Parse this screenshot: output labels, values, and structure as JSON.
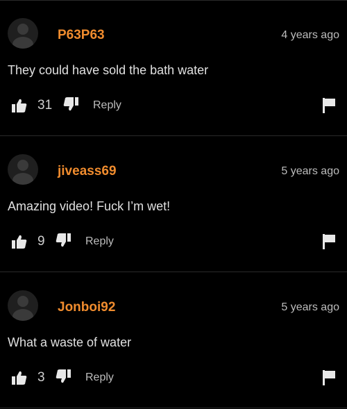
{
  "comments": [
    {
      "username": "P63P63",
      "timestamp": "4 years ago",
      "text": "They could have sold the bath water",
      "votes": "31",
      "reply_label": "Reply",
      "avatar_icon": "default-avatar-icon",
      "flag_icon": "flag-icon"
    },
    {
      "username": "jiveass69",
      "timestamp": "5 years ago",
      "text": "Amazing video! Fuck I’m wet!",
      "votes": "9",
      "reply_label": "Reply",
      "avatar_icon": "default-avatar-icon",
      "flag_icon": "flag-icon"
    },
    {
      "username": "Jonboi92",
      "timestamp": "5 years ago",
      "text": "What a waste of water",
      "votes": "3",
      "reply_label": "Reply",
      "avatar_icon": "default-avatar-icon",
      "flag_icon": "flag-icon"
    }
  ],
  "colors": {
    "background": "#000000",
    "username": "#f08c2e",
    "text": "#e0e0e0",
    "muted": "#bdbdbd",
    "divider": "#2a2a2a"
  }
}
